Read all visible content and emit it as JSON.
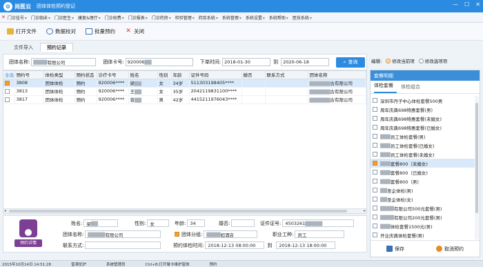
{
  "titlebar": {
    "brand": "尚医云",
    "title": "团体体检预约登记",
    "min": "—",
    "max": "☐",
    "close": "✕"
  },
  "menu": [
    "门诊挂号",
    "门诊临床",
    "门诊医生",
    "康复&理疗",
    "门诊收费",
    "门诊报表",
    "门诊药房",
    "检验管理",
    "药库系统",
    "系统管理",
    "系统设置",
    "系统帮助",
    "医技系统"
  ],
  "toolbar": {
    "open": "打开文件",
    "verify": "数据校对",
    "batch": "批量预约",
    "close": "关闭"
  },
  "tabs": {
    "import": "文件导入",
    "records": "预约记录"
  },
  "filter": {
    "group_label": "团体名称:",
    "group_value": "有限公司",
    "card_label": "团体卡号:",
    "card_value": "920006",
    "date_label": "下单时间:",
    "date_from": "2018-01-30",
    "to_label": "到",
    "date_to": "2020-06-18",
    "search": "查询"
  },
  "grid": {
    "headers": [
      "全选",
      "预约号",
      "体检类型",
      "预约状态",
      "诊疗卡号",
      "姓名",
      "性别",
      "年龄",
      "证件号码",
      "婚否",
      "联系方式",
      "团体名称"
    ],
    "rows": [
      {
        "id": "3808",
        "type": "团体体检",
        "status": "预约",
        "card": "920006****",
        "name": "梁",
        "sex": "女",
        "age": "34岁",
        "idno": "511303198405**** ",
        "married": "",
        "phone": "",
        "company": "古有限公司",
        "checked": true
      },
      {
        "id": "3813",
        "type": "团体体检",
        "status": "预约",
        "card": "920006****",
        "name": "王",
        "sex": "女",
        "age": "35岁",
        "idno": "2042119831100****",
        "married": "",
        "phone": "",
        "company": "古有限公司",
        "checked": false
      },
      {
        "id": "3817",
        "type": "团体体检",
        "status": "预约",
        "card": "920006****",
        "name": "曾",
        "sex": "男",
        "age": "42岁",
        "idno": "4415211976043****",
        "married": "",
        "phone": "",
        "company": "古有限公司",
        "checked": false
      }
    ]
  },
  "detail": {
    "avatar_btn": "预约详情",
    "name_label": "姓名:",
    "name": "梁",
    "sex_label": "性别:",
    "sex": "女",
    "age_label": "年龄:",
    "age": "34",
    "married_label": "婚否:",
    "married": "",
    "id_label": "证件证号:",
    "id": "4503261",
    "company_label": "团体名称:",
    "company": "有限公司",
    "group_label": "团体分组:",
    "group": "如酒店",
    "job_label": "职业工种:",
    "job": "员工",
    "contact_label": "联系方式:",
    "contact": "",
    "time_label": "预约体检时间:",
    "time_from": "2018-12-13 08:00:00",
    "time_to_label": "到",
    "time_to": "2018-12-13 18:00:00"
  },
  "right": {
    "edit_label": "编辑:",
    "opt_current": "修改当前项",
    "opt_selected": "修改选项项",
    "panel_title": "套餐明细",
    "tab_pkg": "体检套餐",
    "tab_combo": "体检组合",
    "items": [
      {
        "label": "深圳市丹子中心体检套餐500男",
        "checked": false
      },
      {
        "label": "周年庆典698特惠套餐(男)",
        "checked": false
      },
      {
        "label": "周年庆典698特惠套餐(未婚女)",
        "checked": false
      },
      {
        "label": "周年庆典698特惠套餐(已婚女)",
        "checked": false
      },
      {
        "label": "员工体检套餐(男)",
        "checked": false
      },
      {
        "label": "员工体检套餐(已婚女)",
        "checked": false
      },
      {
        "label": "员工体检套餐(未婚女)",
        "checked": false
      },
      {
        "label": "套餐800（未婚女)",
        "checked": true
      },
      {
        "label": "套餐800（已婚女)",
        "checked": false
      },
      {
        "label": "套餐800（男)",
        "checked": false
      },
      {
        "label": "圣企体检(男)",
        "checked": false
      },
      {
        "label": "圣企体检(女)",
        "checked": false
      },
      {
        "label": "有限公司500元套餐(男)",
        "checked": false
      },
      {
        "label": "有限公司200元套餐(男)",
        "checked": false
      },
      {
        "label": "体检套餐1500元(男)",
        "checked": false
      },
      {
        "label": "开业庆典体检套餐(男)",
        "checked": false
      }
    ],
    "save": "保存",
    "cancel": "取消预约"
  },
  "status": [
    "2015年10月14日 14:51:28",
    "曾漂优护",
    "系统管理员",
    "Ctrl+B:打开聚卡维护窗体",
    "预约"
  ]
}
